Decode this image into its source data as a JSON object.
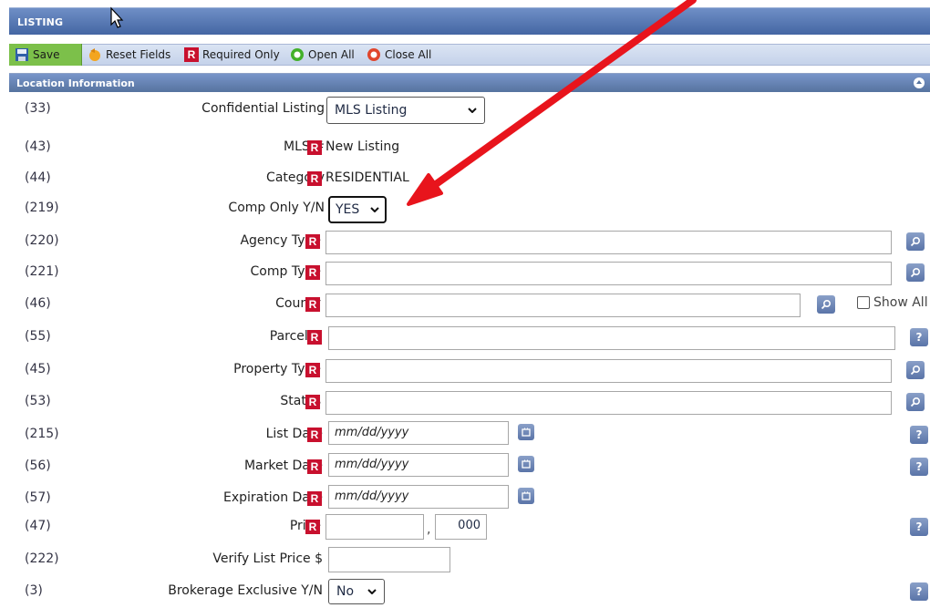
{
  "window": {
    "title": "LISTING"
  },
  "toolbar": {
    "save_label": "Save",
    "reset_label": "Reset Fields",
    "required_badge": "R",
    "required_label": "Required Only",
    "open_label": "Open All",
    "close_label": "Close All"
  },
  "section": {
    "title": "Location Information"
  },
  "badge": "R",
  "date_placeholder": "mm/dd/yyyy",
  "rows": [
    {
      "num": "(33)",
      "label": "Confidential Listing",
      "value": "MLS Listing"
    },
    {
      "num": "(43)",
      "label": "MLS #",
      "value": "New Listing"
    },
    {
      "num": "(44)",
      "label": "Category",
      "value": "RESIDENTIAL"
    },
    {
      "num": "(219)",
      "label": "Comp Only Y/N",
      "value": "YES"
    },
    {
      "num": "(220)",
      "label": "Agency Type",
      "value": ""
    },
    {
      "num": "(221)",
      "label": "Comp Type",
      "value": ""
    },
    {
      "num": "(46)",
      "label": "County",
      "value": "",
      "extra": "Show All"
    },
    {
      "num": "(55)",
      "label": "Parcel #",
      "value": ""
    },
    {
      "num": "(45)",
      "label": "Property Type",
      "value": ""
    },
    {
      "num": "(53)",
      "label": "Status",
      "value": ""
    },
    {
      "num": "(215)",
      "label": "List Date",
      "value": "mm/dd/yyyy"
    },
    {
      "num": "(56)",
      "label": "Market Date",
      "value": "mm/dd/yyyy"
    },
    {
      "num": "(57)",
      "label": "Expiration Date",
      "value": "mm/dd/yyyy"
    },
    {
      "num": "(47)",
      "label": "Price",
      "value": "",
      "cents": "000"
    },
    {
      "num": "(222)",
      "label": "Verify List Price $",
      "value": ""
    },
    {
      "num": "(3)",
      "label": "Brokerage Exclusive Y/N",
      "value": "No"
    }
  ],
  "help_glyph": "?",
  "colors": {
    "required_red": "#c8102e",
    "header_blue": "#4466a3",
    "save_green": "#7cc04a",
    "annotation_arrow": "#e8141c"
  }
}
